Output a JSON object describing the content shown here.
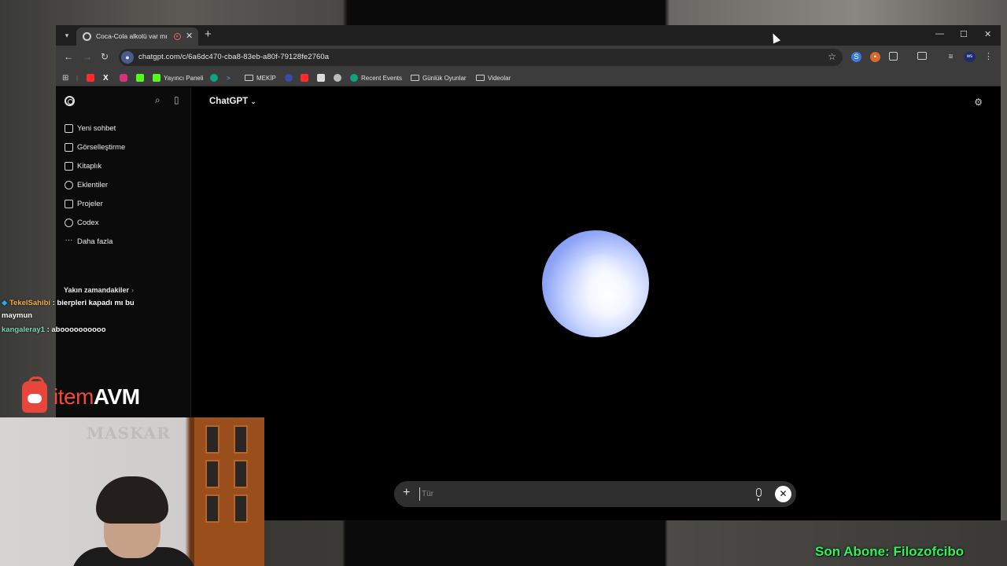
{
  "browser": {
    "tab": {
      "title": "Coca-Cola alkolü var mı",
      "favicon": "chatgpt-icon"
    },
    "window_controls": [
      "minimize",
      "maximize",
      "close"
    ],
    "url": "chatgpt.com/c/6a6dc470-cba8-83eb-a80f-79128fe2760a",
    "bookmarks": [
      {
        "label": "",
        "icon": "youtube-icon",
        "color": "#ff2b2b"
      },
      {
        "label": "",
        "icon": "x-icon",
        "color": "#111111"
      },
      {
        "label": "",
        "icon": "instagram-icon",
        "color": "#d6337a"
      },
      {
        "label": "",
        "icon": "kick-icon",
        "color": "#53fc18"
      },
      {
        "label": "Yayıncı Paneli",
        "icon": "kick-icon",
        "color": "#53fc18"
      },
      {
        "label": "",
        "icon": "chatgpt-icon",
        "color": "#10a37f"
      },
      {
        "label": "",
        "icon": "arrow-icon",
        "color": "#3b6cff"
      },
      {
        "label": "MEKİP",
        "icon": "folder-icon",
        "color": ""
      },
      {
        "label": "",
        "icon": "globe-icon",
        "color": "#3b4aa8"
      },
      {
        "label": "",
        "icon": "youtube-icon",
        "color": "#ff2b2b"
      },
      {
        "label": "",
        "icon": "image-icon",
        "color": "#dddddd"
      },
      {
        "label": "",
        "icon": "chatgpt-icon",
        "color": "#bbbbbb"
      },
      {
        "label": "Recent Events",
        "icon": "chatgpt-icon",
        "color": "#10a37f"
      },
      {
        "label": "Günlük Oyunlar",
        "icon": "folder-icon",
        "color": ""
      },
      {
        "label": "Videolar",
        "icon": "folder-icon",
        "color": ""
      }
    ]
  },
  "chatgpt": {
    "model": "ChatGPT",
    "sidebar": {
      "items": [
        {
          "label": "Yeni sohbet",
          "icon": "new-chat-icon"
        },
        {
          "label": "Görselleştirme",
          "icon": "image-gen-icon"
        },
        {
          "label": "Kitaplık",
          "icon": "library-icon"
        },
        {
          "label": "Eklentiler",
          "icon": "apps-icon"
        },
        {
          "label": "Projeler",
          "icon": "folder-icon"
        },
        {
          "label": "Codex",
          "icon": "codex-icon"
        },
        {
          "label": "Daha fazla",
          "icon": "more-icon"
        }
      ],
      "recent_label": "Yakın zamandakiler"
    },
    "composer": {
      "placeholder": "Tür"
    },
    "orb_colors": {
      "center": "#ffffff",
      "edge": "#6e85ef"
    }
  },
  "stream": {
    "chat": [
      {
        "user": "TekelSahibi",
        "message": ": bierpleri kapadı mı bu",
        "message_cont": "maymun"
      },
      {
        "user": "kangaleray1",
        "message": ": aboooooooooo"
      }
    ],
    "sponsor": {
      "part1": "item",
      "part2": "AVM"
    },
    "webcam_plate": "MASKAR",
    "subscriber_banner": "Son Abone: Filozofcibo"
  }
}
